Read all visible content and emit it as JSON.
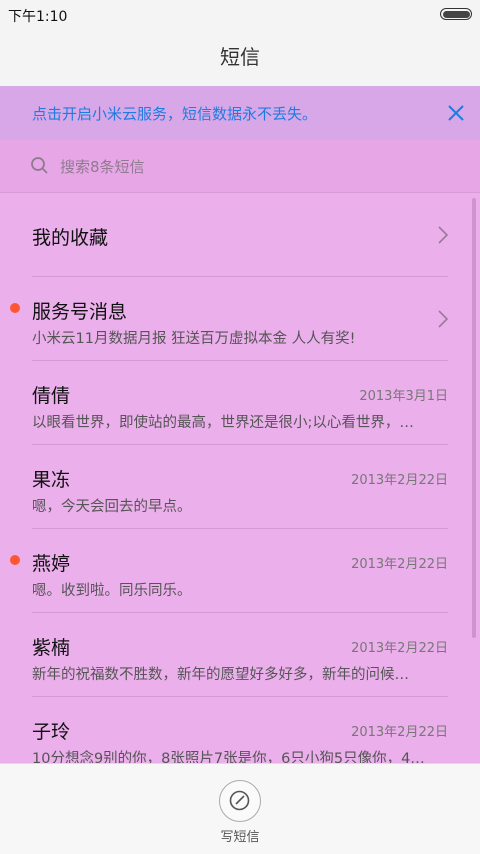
{
  "status": {
    "time": "下午1:10"
  },
  "title": "短信",
  "banner": {
    "text": "点击开启小米云服务，短信数据永不丢失。"
  },
  "search": {
    "placeholder": "搜索8条短信"
  },
  "conversations": [
    {
      "name": "我的收藏",
      "preview": "",
      "date": "",
      "unread": false,
      "chevron": true
    },
    {
      "name": "服务号消息",
      "preview": "小米云11月数据月报 狂送百万虚拟本金 人人有奖!",
      "date": "",
      "unread": true,
      "chevron": true
    },
    {
      "name": "倩倩",
      "preview": "以眼看世界，即使站的最高，世界还是很小;以心看世界，…",
      "date": "2013年3月1日",
      "unread": false,
      "chevron": false
    },
    {
      "name": "果冻",
      "preview": "嗯，今天会回去的早点。",
      "date": "2013年2月22日",
      "unread": false,
      "chevron": false
    },
    {
      "name": "燕婷",
      "preview": "嗯。收到啦。同乐同乐。",
      "date": "2013年2月22日",
      "unread": true,
      "chevron": false
    },
    {
      "name": "紫楠",
      "preview": "新年的祝福数不胜数，新年的愿望好多好多，新年的问候…",
      "date": "2013年2月22日",
      "unread": false,
      "chevron": false
    },
    {
      "name": "子玲",
      "preview": "10分想念9别的你，8张照片7张是你，6只小狗5只像你，4…",
      "date": "2013年2月22日",
      "unread": false,
      "chevron": false
    }
  ],
  "compose": {
    "label": "写短信"
  },
  "colors": {
    "accent": "#1e7ce0",
    "unread_dot": "#ff5533",
    "background": "#ebafeb"
  }
}
